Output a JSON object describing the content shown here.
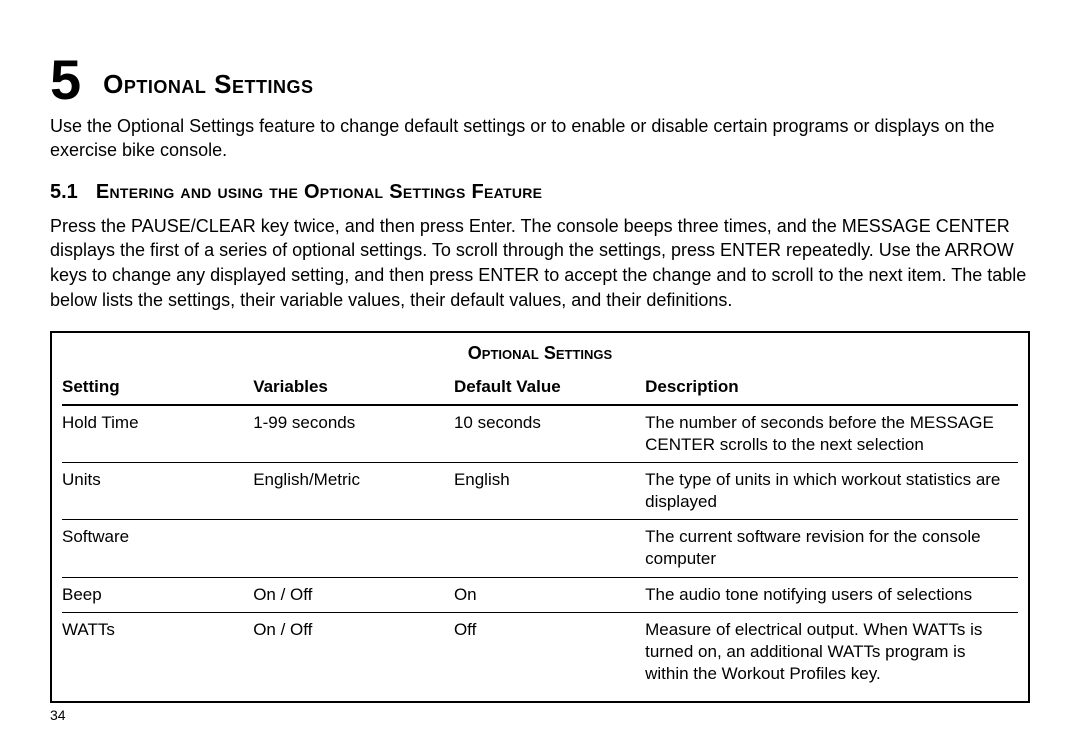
{
  "chapter": {
    "number": "5",
    "title": "Optional Settings",
    "intro": "Use the Optional Settings feature to change default settings or to enable or disable certain programs or displays on the exercise bike console."
  },
  "section": {
    "number": "5.1",
    "title": "Entering and using the Optional Settings Feature",
    "body": "Press the PAUSE/CLEAR key twice, and then press Enter. The console beeps three times, and the MESSAGE CENTER displays the first of a series of optional settings. To scroll through the settings, press ENTER repeatedly. Use the ARROW keys to change any displayed setting, and then press ENTER to accept the change and to scroll to the next item. The table below lists the settings, their variable values, their default values, and their definitions."
  },
  "table": {
    "title": "Optional Settings",
    "headers": {
      "setting": "Setting",
      "variables": "Variables",
      "default": "Default Value",
      "description": "Description"
    },
    "rows": [
      {
        "setting": "Hold Time",
        "variables": "1-99 seconds",
        "default": "10 seconds",
        "description": "The number of seconds before the MESSAGE CENTER scrolls to the next selection"
      },
      {
        "setting": "Units",
        "variables": "English/Metric",
        "default": "English",
        "description": "The type of units in which workout statistics are displayed"
      },
      {
        "setting": "Software",
        "variables": "",
        "default": "",
        "description": "The current software revision for the console computer"
      },
      {
        "setting": "Beep",
        "variables": "On / Off",
        "default": "On",
        "description": "The audio tone notifying users of selections"
      },
      {
        "setting": "WATTs",
        "variables": "On / Off",
        "default": "Off",
        "description": "Measure of electrical output. When WATTs is turned on, an additional WATTs program is within the Workout Profiles key."
      }
    ]
  },
  "page_number": "34"
}
